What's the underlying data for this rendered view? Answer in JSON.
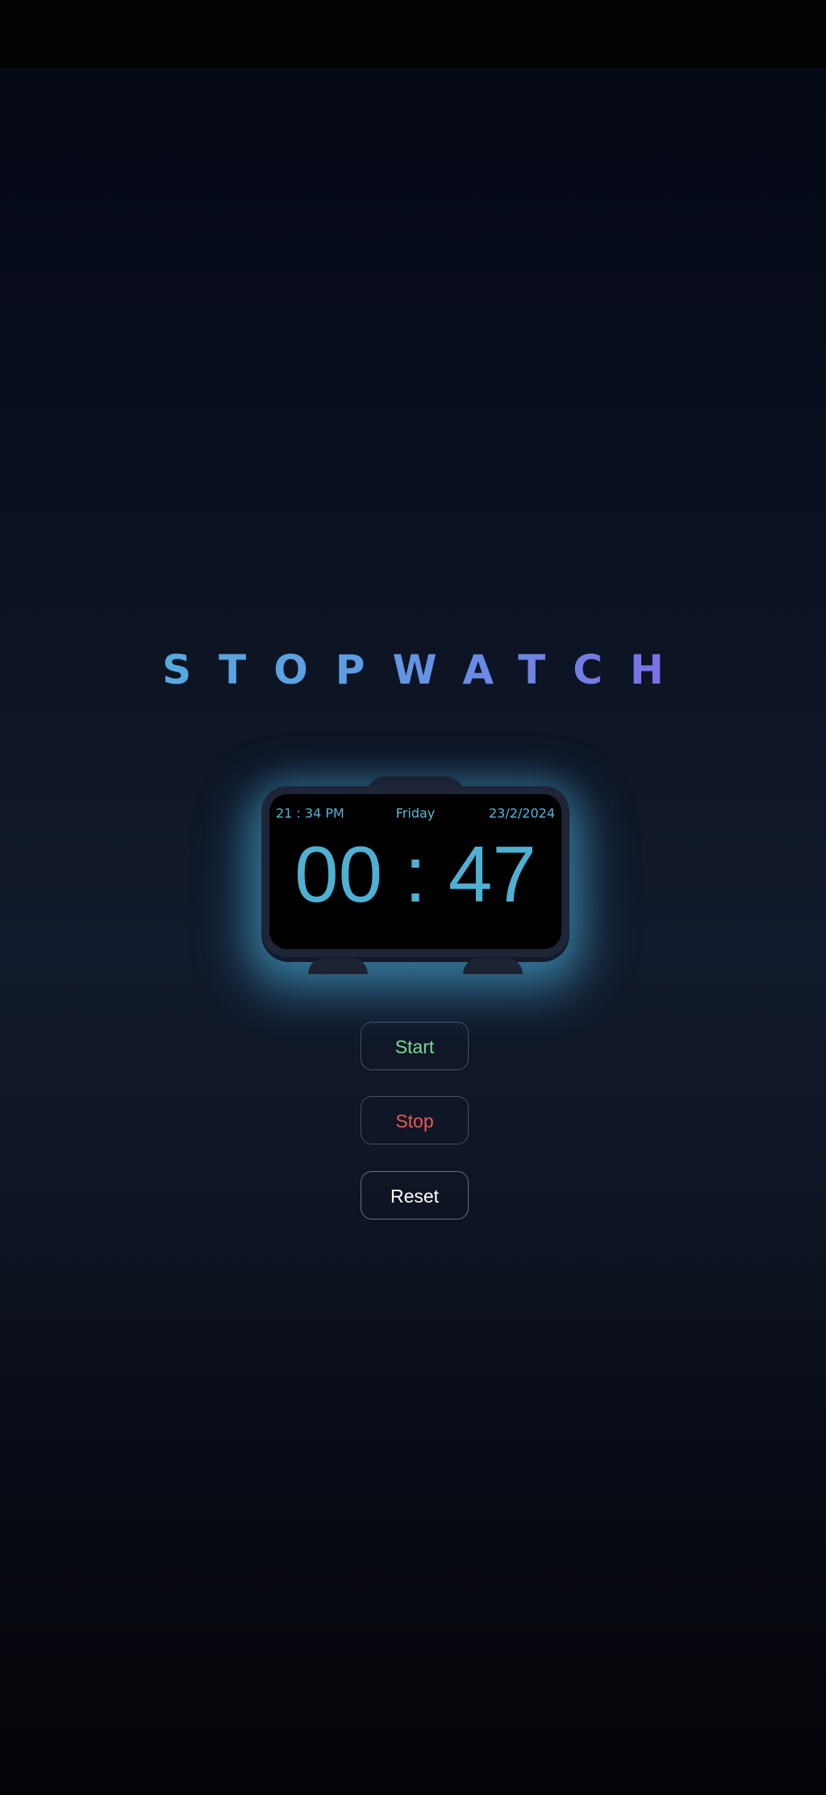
{
  "app": {
    "title": "STOPWATCH"
  },
  "display": {
    "clock_time": "21 : 34 PM",
    "weekday": "Friday",
    "date": "23/2/2024",
    "elapsed": "00 : 47"
  },
  "controls": {
    "start_label": "Start",
    "stop_label": "Stop",
    "reset_label": "Reset"
  },
  "colors": {
    "accent": "#4fb0d3",
    "title_gradient_start": "#4fb3da",
    "title_gradient_end": "#8d5ce8",
    "start": "#7ed891",
    "stop": "#e85a55",
    "reset": "#ffffff",
    "glow": "#48aad6"
  }
}
